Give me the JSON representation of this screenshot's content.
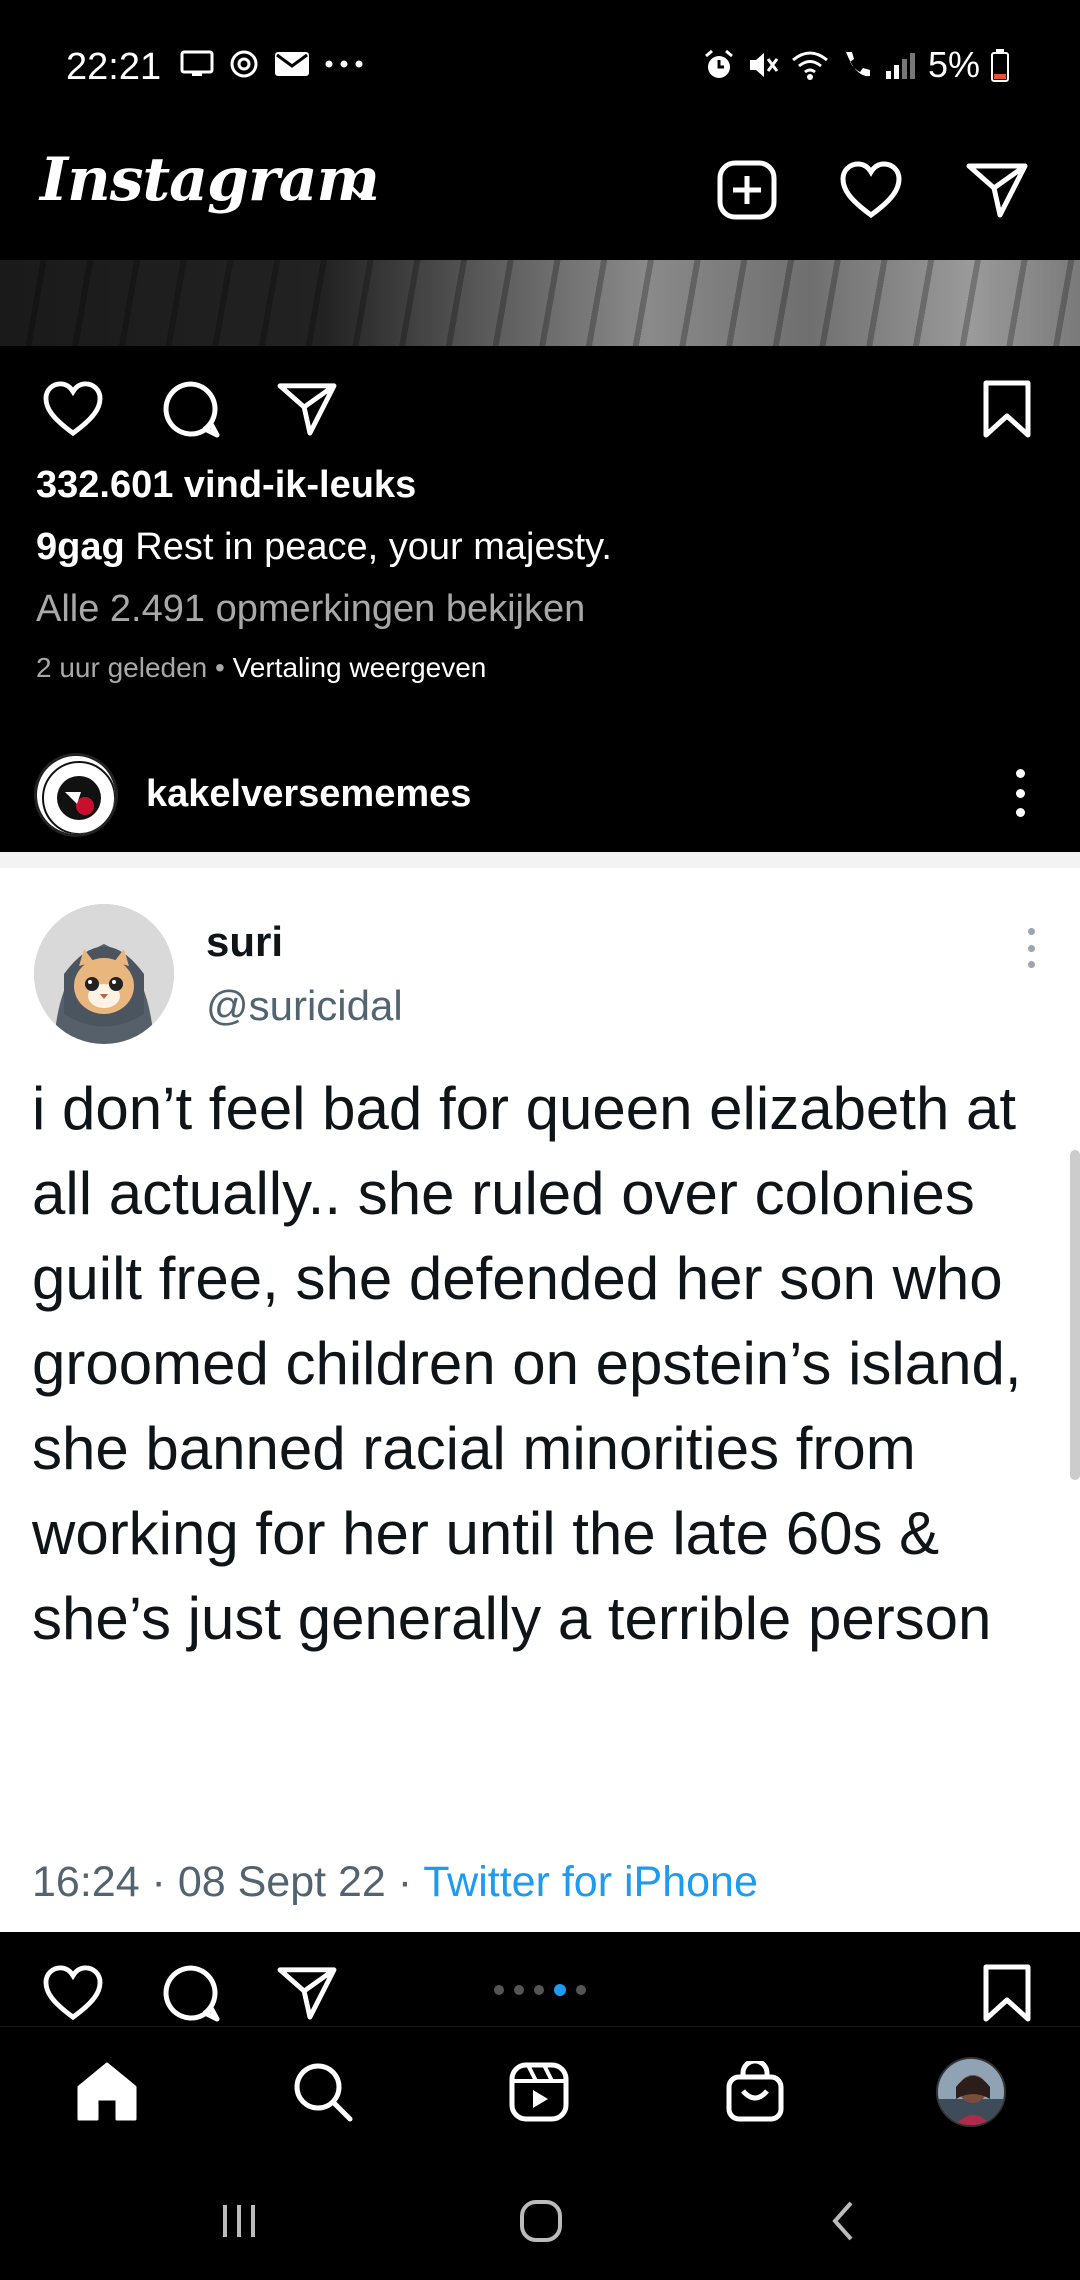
{
  "status_bar": {
    "time": "22:21",
    "battery": "5%",
    "left_icons": [
      "screen-icon",
      "sync-icon",
      "mail-icon",
      "more-dots-icon"
    ],
    "right_icons": [
      "alarm-icon",
      "mute-icon",
      "wifi-icon",
      "wifi-call-icon",
      "signal-icon",
      "battery-icon"
    ]
  },
  "header": {
    "logo": "Instagram",
    "icons": [
      "new-post-icon",
      "heart-icon",
      "direct-message-icon"
    ]
  },
  "post1": {
    "likes": "332.601 vind-ik-leuks",
    "caption_user": "9gag",
    "caption_text": " Rest in peace, your majesty.",
    "comments_link": "Alle 2.491 opmerkingen bekijken",
    "time_ago": "2 uur geleden",
    "separator": " • ",
    "translate": "Vertaling weergeven"
  },
  "post2": {
    "username": "kakelversememes",
    "tweet": {
      "name": "suri",
      "handle": "@suricidal",
      "text": "i don’t feel bad for queen elizabeth at all actually.. she ruled over colonies guilt free, she defended her son who groomed children on epstein’s island, she banned racial minorities from working for her until the late 60s & she’s just generally a terrible person",
      "time": "16:24",
      "sep1": " · ",
      "date": "08 Sept 22",
      "sep2": " · ",
      "source": "Twitter for iPhone"
    },
    "carousel": {
      "count": 5,
      "active_index": 3
    }
  },
  "bottom_nav": {
    "items": [
      "home-icon",
      "search-icon",
      "reels-icon",
      "shop-icon",
      "profile-avatar"
    ]
  },
  "system_nav": {
    "items": [
      "recents-icon",
      "home-circle-icon",
      "back-icon"
    ]
  },
  "colors": {
    "background": "#000000",
    "secondary_text": "#a8a8a8",
    "tweet_link": "#1d9bf0",
    "tweet_gray": "#536471"
  }
}
